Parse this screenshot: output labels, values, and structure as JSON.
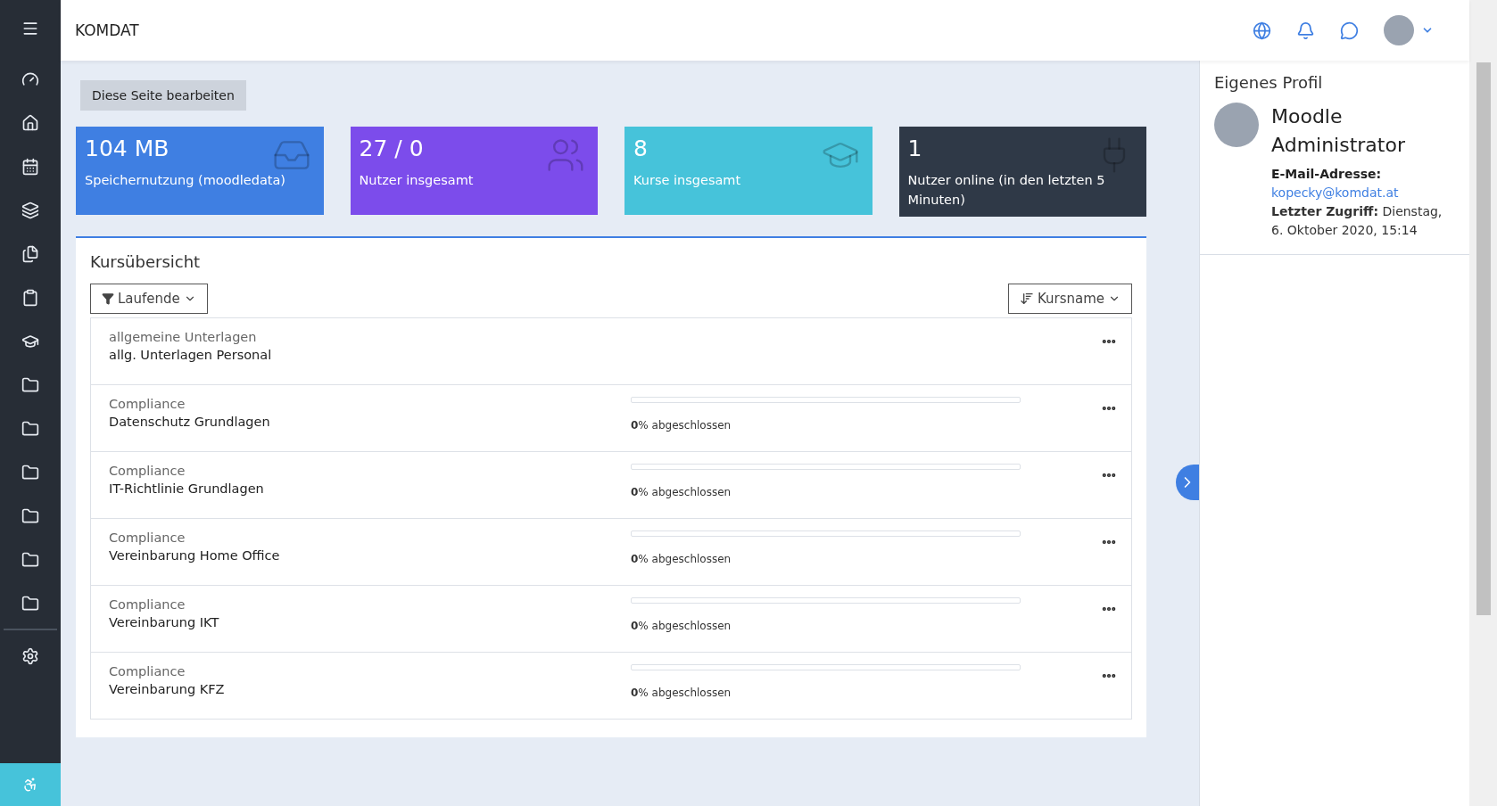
{
  "header": {
    "brand": "KOMDAT"
  },
  "edit_button": "Diese Seite bearbeiten",
  "stats": [
    {
      "value": "104 MB",
      "label": "Speichernutzung (moodledata)",
      "color": "#3f7fe2"
    },
    {
      "value": "27 / 0",
      "label": "Nutzer insgesamt",
      "color": "#7c4ceb"
    },
    {
      "value": "8",
      "label": "Kurse insgesamt",
      "color": "#46c3da"
    },
    {
      "value": "1",
      "label": "Nutzer online (in den letzten 5 Minuten)",
      "color": "#2f3947"
    }
  ],
  "course_overview": {
    "title": "Kursübersicht",
    "filter": "Laufende",
    "sort": "Kursname",
    "courses": [
      {
        "category": "allgemeine Unterlagen",
        "name": "allg. Unterlagen Personal"
      },
      {
        "category": "Compliance",
        "name": "Datenschutz Grundlagen",
        "progress": {
          "level": 0,
          "label": "**0**% abgeschlossen"
        }
      },
      {
        "category": "Compliance",
        "name": "IT-Richtlinie Grundlagen",
        "progress": {
          "level": 0,
          "label": "**0**% abgeschlossen"
        }
      },
      {
        "category": "Compliance",
        "name": "Vereinbarung Home Office",
        "progress": {
          "level": 0,
          "label": "**0**% abgeschlossen"
        }
      },
      {
        "category": "Compliance",
        "name": "Vereinbarung IKT",
        "progress": {
          "level": 0,
          "label": "**0**% abgeschlossen"
        }
      },
      {
        "category": "Compliance",
        "name": "Vereinbarung KFZ",
        "progress": {
          "level": 0,
          "label": "**0**% abgeschlossen"
        }
      }
    ]
  },
  "profile": {
    "title": "Eigenes Profil",
    "name": "Moodle Administrator",
    "email_label": "E-Mail-Adresse:",
    "email": "kopecky@komdat.at",
    "last_access_label": "Letzter Zugriff:",
    "last_access": "Dienstag, 6. Oktober 2020, 15:14"
  }
}
